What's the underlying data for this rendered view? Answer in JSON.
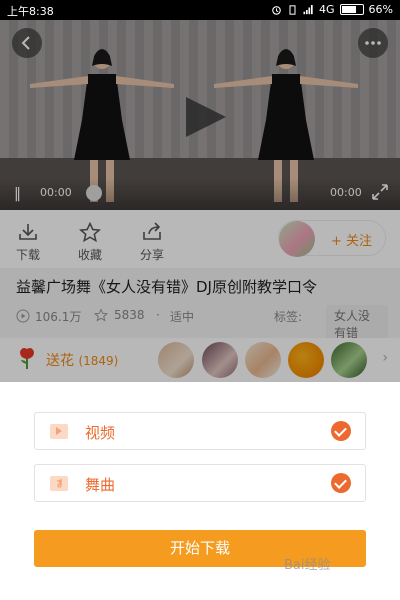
{
  "status_bar": {
    "time": "上午8:38",
    "network": "4G",
    "battery": "66%"
  },
  "video": {
    "current_time": "00:00",
    "total_time": "00:00"
  },
  "actions": [
    {
      "label": "下载",
      "icon": "download-icon"
    },
    {
      "label": "收藏",
      "icon": "star-icon"
    },
    {
      "label": "分享",
      "icon": "share-icon"
    }
  ],
  "follow": {
    "label": "+ 关注"
  },
  "video_info": {
    "title": "益馨广场舞《女人没有错》DJ原创附教学口令",
    "plays": "106.1万",
    "favorites": "5838",
    "dot": "·",
    "quality": "适中",
    "tag_label": "标签:",
    "tag": "女人没有错"
  },
  "flowers": {
    "label": "送花",
    "count": "(1849)"
  },
  "sheet": {
    "options": [
      {
        "label": "视频",
        "checked": true
      },
      {
        "label": "舞曲",
        "checked": true
      }
    ],
    "download_button": "开始下载"
  },
  "watermark": "Bai经验"
}
